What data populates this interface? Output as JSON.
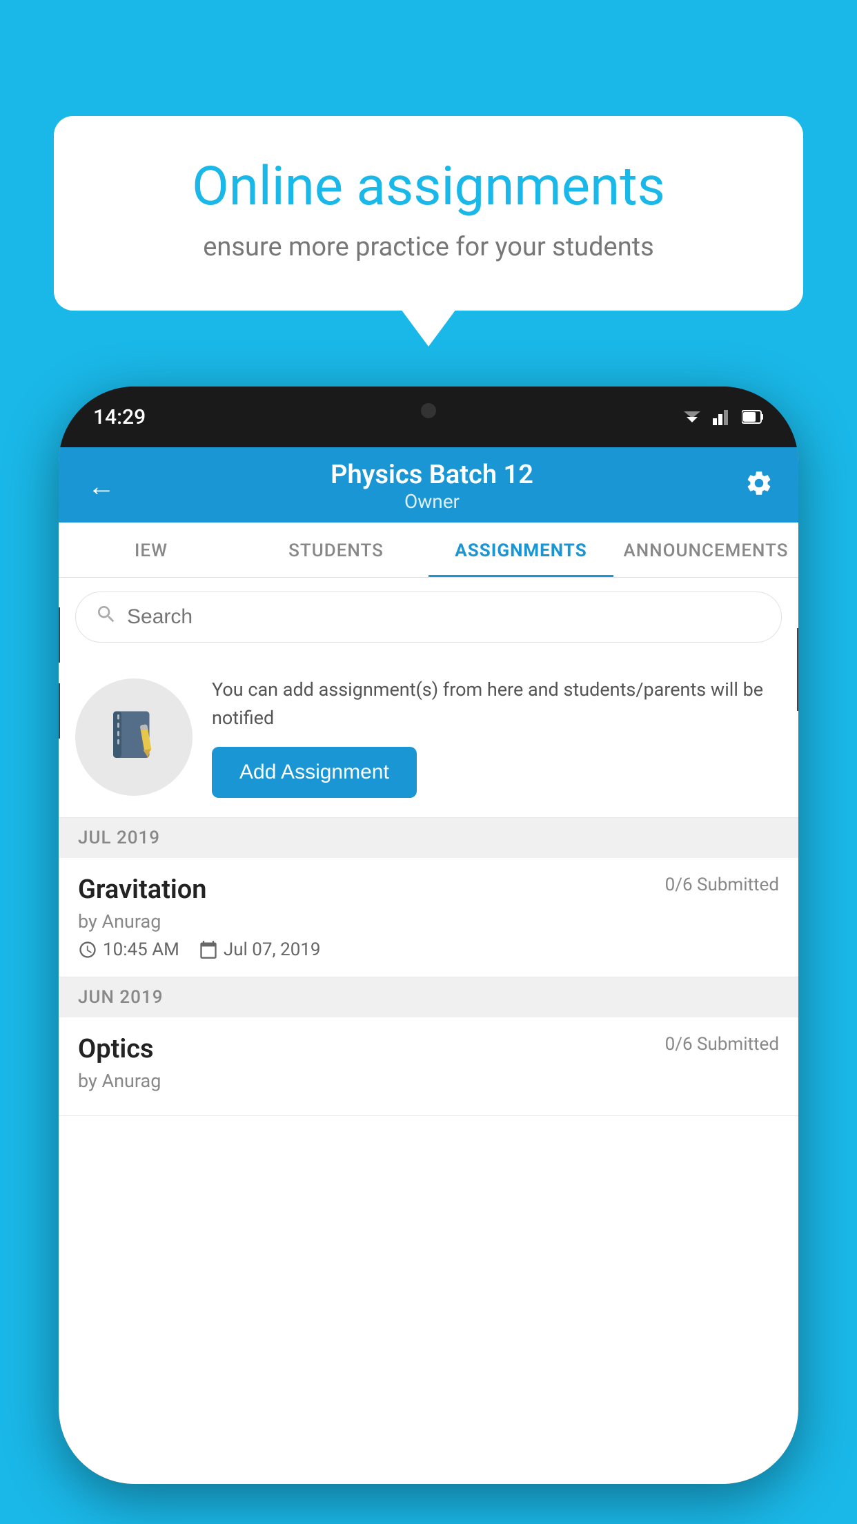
{
  "background_color": "#1ab8e8",
  "speech_bubble": {
    "title": "Online assignments",
    "subtitle": "ensure more practice for your students"
  },
  "phone": {
    "status_bar": {
      "time": "14:29"
    },
    "header": {
      "title": "Physics Batch 12",
      "subtitle": "Owner",
      "back_label": "←",
      "settings_label": "⚙"
    },
    "tabs": [
      {
        "label": "IEW",
        "active": false
      },
      {
        "label": "STUDENTS",
        "active": false
      },
      {
        "label": "ASSIGNMENTS",
        "active": true
      },
      {
        "label": "ANNOUNCEMENTS",
        "active": false
      }
    ],
    "search": {
      "placeholder": "Search"
    },
    "promo": {
      "text": "You can add assignment(s) from here and students/parents will be notified",
      "button_label": "Add Assignment"
    },
    "sections": [
      {
        "month": "JUL 2019",
        "assignments": [
          {
            "title": "Gravitation",
            "submitted": "0/6 Submitted",
            "by": "by Anurag",
            "time": "10:45 AM",
            "date": "Jul 07, 2019"
          }
        ]
      },
      {
        "month": "JUN 2019",
        "assignments": [
          {
            "title": "Optics",
            "submitted": "0/6 Submitted",
            "by": "by Anurag",
            "time": "",
            "date": ""
          }
        ]
      }
    ]
  }
}
